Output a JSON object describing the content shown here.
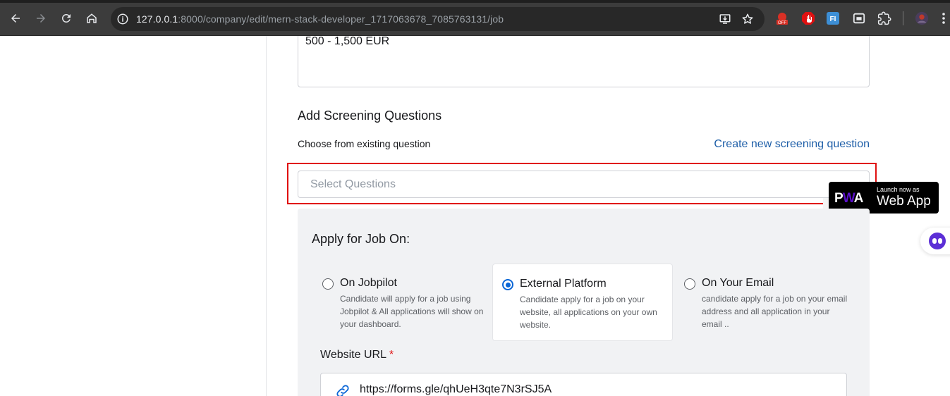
{
  "browser": {
    "url_host": "127.0.0.1",
    "url_rest": ":8000/company/edit/mern-stack-developer_1717063678_7085763131/job",
    "icons": [
      "back-icon",
      "forward-icon",
      "reload-icon",
      "home-icon",
      "site-info-icon",
      "install-icon",
      "bookmark-star-icon",
      "extension-off-icon",
      "extension-adblock-icon",
      "extension-fi-icon",
      "extension-window-icon",
      "extensions-puzzle-icon",
      "profile-avatar",
      "menu-kebab-icon"
    ],
    "ext_off_label": "OFF",
    "ext_fi_label": "FI"
  },
  "form": {
    "salary_value": "500 - 1,500 EUR",
    "screening_title": "Add Screening Questions",
    "choose_label": "Choose from existing question",
    "create_link": "Create new screening question",
    "select_placeholder": "Select Questions",
    "apply_title": "Apply for Job On:",
    "options": [
      {
        "title": "On Jobpilot",
        "desc": "Candidate will apply for a job using Jobpilot & All applications will show on your dashboard.",
        "selected": false
      },
      {
        "title": "External Platform",
        "desc": "Candidate apply for a job on your website, all applications on your own website.",
        "selected": true
      },
      {
        "title": "On Your Email",
        "desc": "candidate apply for a job on your email address and all application in your email ..",
        "selected": false
      }
    ],
    "website_url_label": "Website URL",
    "required_mark": "*",
    "website_url_value": "https://forms.gle/qhUeH3qte7N3rSJ5A"
  },
  "pwa": {
    "logo_p": "P",
    "logo_w": "W",
    "logo_a": "A",
    "small": "Launch now as",
    "big": "Web App"
  },
  "colors": {
    "highlight": "#e01010",
    "link": "#1f5fa8",
    "radio_selected": "#0a66d6",
    "panel": "#f1f2f4"
  }
}
